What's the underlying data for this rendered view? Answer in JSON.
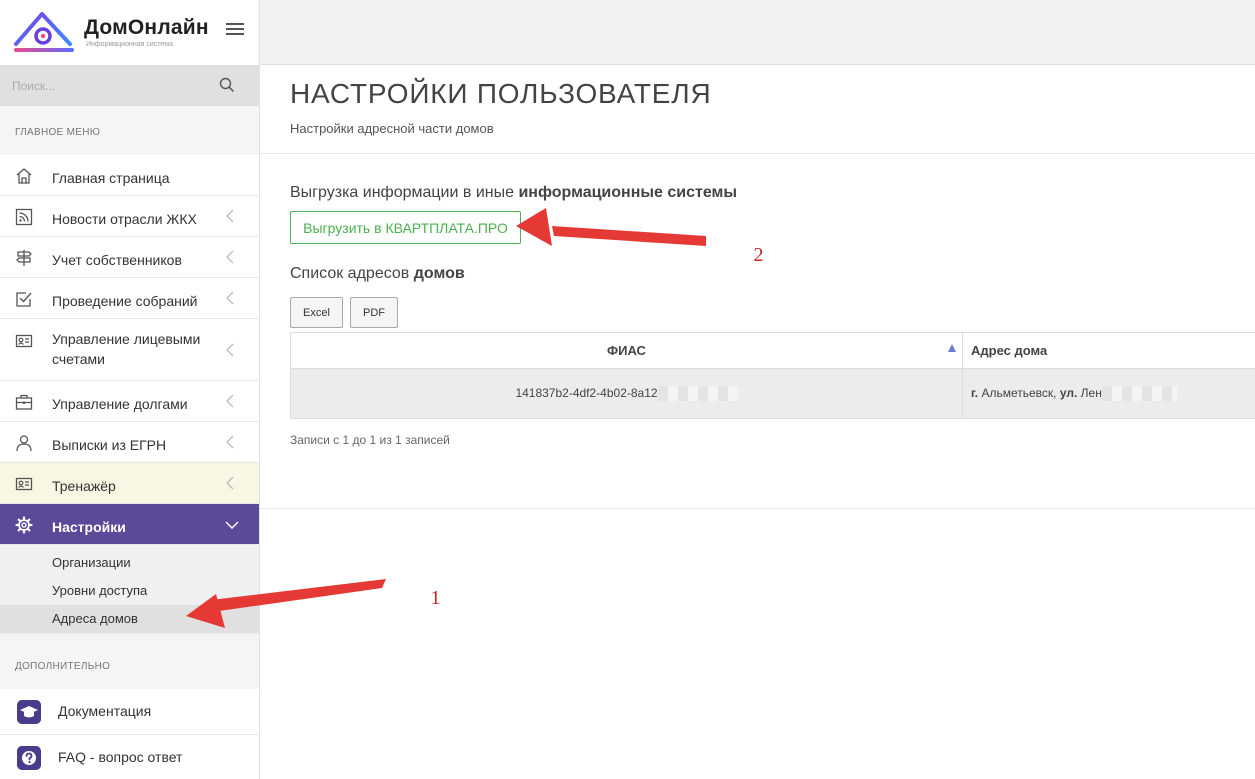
{
  "app": {
    "name": "ДомОнлайн",
    "subtitle": "Информационная система"
  },
  "search": {
    "placeholder": "Поиск..."
  },
  "sidebar": {
    "main_section": "ГЛАВНОЕ МЕНЮ",
    "items": [
      {
        "label": "Главная страница",
        "icon": "home-icon"
      },
      {
        "label": "Новости отрасли ЖКХ",
        "icon": "rss-icon"
      },
      {
        "label": "Учет собственников",
        "icon": "signpost-icon"
      },
      {
        "label": "Проведение собраний",
        "icon": "checkbox-icon"
      },
      {
        "label": "Управление лицевыми счетами",
        "icon": "id-card-icon"
      },
      {
        "label": "Управление долгами",
        "icon": "briefcase-icon"
      },
      {
        "label": "Выписки из ЕГРН",
        "icon": "user-icon"
      },
      {
        "label": "Тренажёр",
        "icon": "id-card-icon"
      },
      {
        "label": "Настройки",
        "icon": "gear-icon"
      }
    ],
    "settings_sub": [
      {
        "label": "Организации"
      },
      {
        "label": "Уровни доступа"
      },
      {
        "label": "Адреса домов"
      }
    ],
    "extra_section": "ДОПОЛНИТЕЛЬНО",
    "extra_items": [
      {
        "label": "Документация",
        "icon": "graduation-cap-icon"
      },
      {
        "label": "FAQ - вопрос ответ",
        "icon": "question-icon"
      }
    ]
  },
  "page": {
    "title": "НАСТРОЙКИ ПОЛЬЗОВАТЕЛЯ",
    "subtitle": "Настройки адресной части домов",
    "export_title_prefix": "Выгрузка информации в иные ",
    "export_title_bold": "информационные системы",
    "export_button": "Выгрузить в КВАРТПЛАТА.ПРО",
    "list_title_prefix": "Список адресов ",
    "list_title_bold": "домов",
    "btn_excel": "Excel",
    "btn_pdf": "PDF",
    "table": {
      "headers": [
        "ФИАС",
        "Адрес дома"
      ],
      "rows": [
        {
          "fias": "141837b2-4df2-4b02-8a12",
          "city_prefix": "г.",
          "city": " Альметьевск, ",
          "street_prefix": "ул.",
          "street": " Лен"
        }
      ]
    },
    "records_info": "Записи с 1 до 1 из 1 записей"
  },
  "annotations": {
    "callout_1": "1",
    "callout_2": "2",
    "arrow_color": "#e53935"
  }
}
